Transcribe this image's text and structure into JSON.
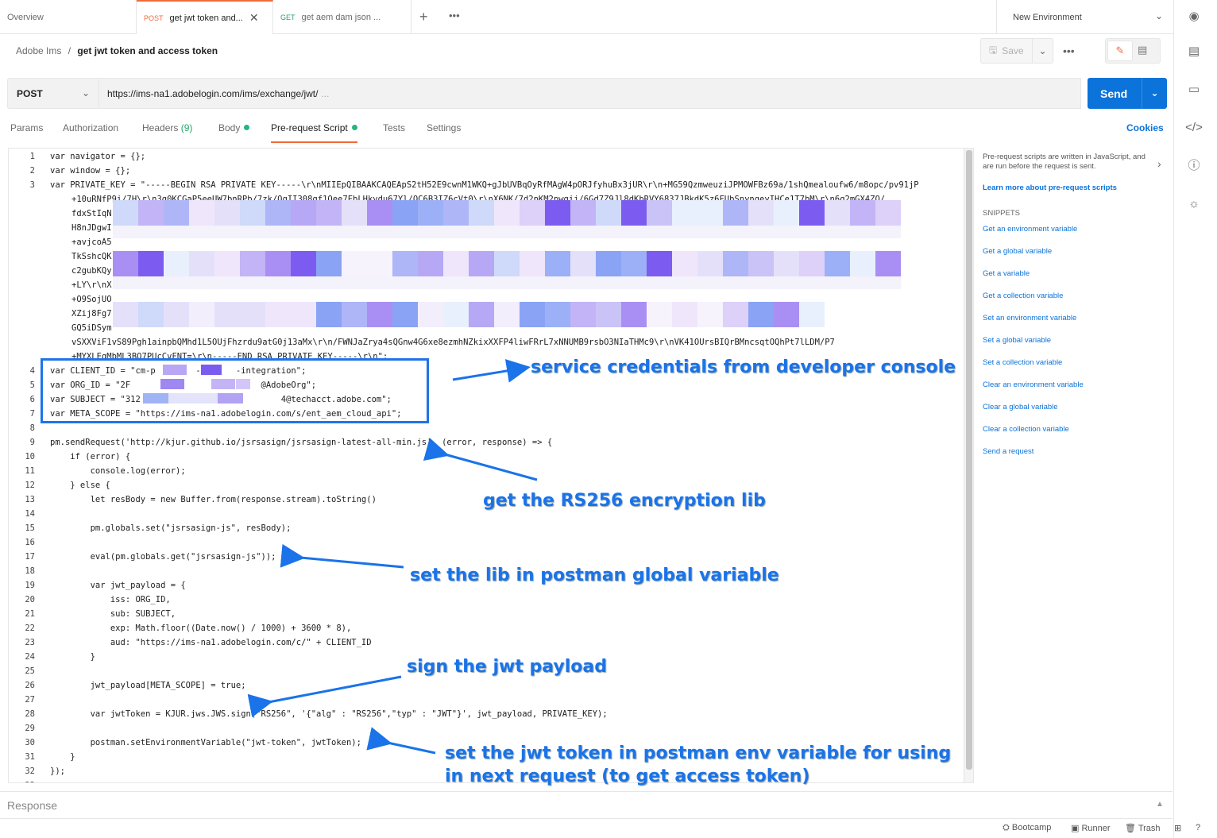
{
  "tabs": [
    {
      "method": "",
      "label": "Overview"
    },
    {
      "method": "POST",
      "label": "get jwt token and...",
      "active": true
    },
    {
      "method": "GET",
      "label": "get aem dam json ..."
    }
  ],
  "environment": "New Environment",
  "breadcrumb": {
    "collection": "Adobe Ims",
    "separator": "/",
    "request": "get jwt token and access token"
  },
  "toolbar": {
    "save_label": "Save"
  },
  "request": {
    "method": "POST",
    "url": "https://ims-na1.adobelogin.com/ims/exchange/jwt/",
    "url_more": "...",
    "send_label": "Send"
  },
  "request_tabs": [
    {
      "label": "Params"
    },
    {
      "label": "Authorization"
    },
    {
      "label": "Headers",
      "count": "(9)"
    },
    {
      "label": "Body"
    },
    {
      "label": "Pre-request Script"
    },
    {
      "label": "Tests"
    },
    {
      "label": "Settings"
    }
  ],
  "cookies_label": "Cookies",
  "code": {
    "line1": "var navigator = {};",
    "line2": "var window = {};",
    "line3a": "var PRIVATE_KEY = \"-----BEGIN RSA PRIVATE KEY-----\\r\\nMIIEpQIBAAKCAQEApS2tH52E9cwnM1WKQ+gJbUVBqOyRfMAgW4pORJfyhuBx3jUR\\r\\n+MG59QzmweuziJPMOWFBz69a/1shQmealoufw6/m8opc/pv91jP",
    "line3b": "+10uRNfP9i/7H\\r\\n3g0KCGaP5eeUW7bnRPb/7zk/QqII308qf1Oee7FbLHkvdu67Yl/OC6B3IZ6cVt0\\r\\nX6NK/7d2pKM2pwgij/6Gd7Z9Jl8dKbRVY6837JBkdK5z6FUbSnyngeyIHCe1T7bM\\r\\n6q2mGX4ZO/",
    "line3c": "fdxStIqN",
    "line3d": "H8nJDgwI",
    "line3e": "+avjcoA5",
    "line3f": "TkSshcQK",
    "line3g": "c2gubKQy",
    "line3h": "+LY\\r\\nX",
    "line3i": "+O9SojUO",
    "line3j": "XZij8Fg7",
    "line3k": "GQ5iDSym",
    "line3l": "vSXXViF1vS89Pgh1ainpbQMhd1L5OUjFhzrdu9atG0j13aMx\\r\\n/FWNJaZrya4sQGnw4G6xe8ezmhNZkixXXFP4liwFRrL7xNNUMB9rsbO3NIaTHMc9\\r\\nVK41OUrsBIQrBMncsqtOQhPt7lLDM/P7",
    "line3m": "+MYXLEqMbML3BO7PUcCvFNT=\\r\\n-----END RSA PRIVATE KEY-----\\r\\n\";",
    "line4": "var CLIENT_ID = \"cm-p        -e9     -integration\";",
    "line5": "var ORG_ID = \"2F                          @AdobeOrg\";",
    "line6": "var SUBJECT = \"312                            4@techacct.adobe.com\";",
    "line7": "var META_SCOPE = \"https://ims-na1.adobelogin.com/s/ent_aem_cloud_api\";",
    "line9": "pm.sendRequest('http://kjur.github.io/jsrsasign/jsrsasign-latest-all-min.js', (error, response) => {",
    "line10": "    if (error) {",
    "line11": "        console.log(error);",
    "line12": "    } else {",
    "line13": "        let resBody = new Buffer.from(response.stream).toString()",
    "line15": "        pm.globals.set(\"jsrsasign-js\", resBody);",
    "line17": "        eval(pm.globals.get(\"jsrsasign-js\"));",
    "line19": "        var jwt_payload = {",
    "line20": "            iss: ORG_ID,",
    "line21": "            sub: SUBJECT,",
    "line22": "            exp: Math.floor((Date.now() / 1000) + 3600 * 8),",
    "line23": "            aud: \"https://ims-na1.adobelogin.com/c/\" + CLIENT_ID",
    "line24": "        }",
    "line26": "        jwt_payload[META_SCOPE] = true;",
    "line28": "        var jwtToken = KJUR.jws.JWS.sign(\"RS256\", '{\"alg\" : \"RS256\",\"typ\" : \"JWT\"}', jwt_payload, PRIVATE_KEY);",
    "line30": "        postman.setEnvironmentVariable(\"jwt-token\", jwtToken);",
    "line31": "    }",
    "line32": "});"
  },
  "line_numbers": [
    "1",
    "2",
    "3",
    "4",
    "5",
    "6",
    "7",
    "8",
    "9",
    "10",
    "11",
    "12",
    "13",
    "14",
    "15",
    "16",
    "17",
    "18",
    "19",
    "20",
    "21",
    "22",
    "23",
    "24",
    "25",
    "26",
    "27",
    "28",
    "29",
    "30",
    "31",
    "32",
    "33"
  ],
  "annotations": {
    "credentials": "service credentials from developer console",
    "encryption": "get the RS256 encryption lib",
    "global": "set the lib in postman global variable",
    "sign": "sign the jwt payload",
    "env1": "set the jwt token in postman env variable  for using",
    "env2": "in next request (to get access token)"
  },
  "help": {
    "intro": "Pre-request scripts are written in JavaScript, and are run before the request is sent.",
    "learn": "Learn more about pre-request scripts",
    "snippets_heading": "SNIPPETS",
    "snippets": [
      "Get an environment variable",
      "Get a global variable",
      "Get a variable",
      "Get a collection variable",
      "Set an environment variable",
      "Set a global variable",
      "Set a collection variable",
      "Clear an environment variable",
      "Clear a global variable",
      "Clear a collection variable",
      "Send a request"
    ]
  },
  "response_label": "Response",
  "statusbar": {
    "bootcamp": "Bootcamp",
    "runner": "Runner",
    "trash": "Trash"
  },
  "colors": {
    "accent": "#f26b3a",
    "primary": "#0b73d9",
    "annotation": "#1a73e8"
  }
}
